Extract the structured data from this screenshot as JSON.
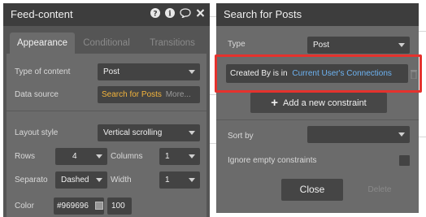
{
  "left_panel": {
    "title": "Feed-content",
    "tabs": [
      {
        "label": "Appearance",
        "active": true
      },
      {
        "label": "Conditional",
        "active": false
      },
      {
        "label": "Transitions",
        "active": false
      }
    ],
    "type_of_content": {
      "label": "Type of content",
      "value": "Post"
    },
    "data_source": {
      "label": "Data source",
      "value": "Search for Posts",
      "more": "More..."
    },
    "layout_style": {
      "label": "Layout style",
      "value": "Vertical scrolling"
    },
    "rows": {
      "label": "Rows",
      "value": "4"
    },
    "columns": {
      "label": "Columns",
      "value": "1"
    },
    "separator": {
      "label": "Separato",
      "value": "Dashed"
    },
    "width": {
      "label": "Width",
      "value": "1"
    },
    "color": {
      "label": "Color",
      "hex": "#969696",
      "opacity": "100",
      "swatch": "#969696"
    }
  },
  "right_panel": {
    "title": "Search for Posts",
    "type": {
      "label": "Type",
      "value": "Post"
    },
    "constraint": {
      "label": "Created By is in",
      "value": "Current User's Connections"
    },
    "add_constraint": "Add a new constraint",
    "sort_by": {
      "label": "Sort by",
      "value": ""
    },
    "ignore_empty": {
      "label": "Ignore empty constraints"
    },
    "close": "Close",
    "delete": "Delete"
  },
  "icons": [
    "help-icon",
    "info-icon",
    "comment-icon",
    "close-icon",
    "plus-icon",
    "trash-icon"
  ],
  "colors": {
    "panel": "#6b6b6b",
    "title_bar": "#3d3d3d",
    "field": "#434343",
    "accent_link": "#6db3f2",
    "data_source": "#f3b43c",
    "highlight": "#e5322d"
  }
}
